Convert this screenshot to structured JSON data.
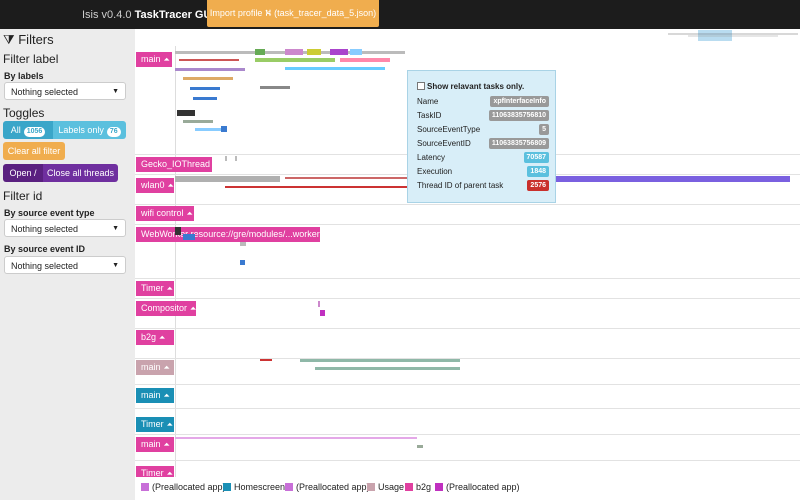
{
  "app": {
    "name": "Isis v0.4.0",
    "product": "TaskTracer GUI"
  },
  "import": {
    "label": "Import profile ⛕ (task_tracer_data_5.json)"
  },
  "sidebar": {
    "filters_heading": "Filters",
    "filter_label": "Filter label",
    "by_labels": "By labels",
    "by_labels_value": "Nothing selected",
    "toggles": "Toggles",
    "all": {
      "label": "All",
      "count": "1056"
    },
    "labels_only": {
      "label": "Labels only",
      "count": "76"
    },
    "clear_all": "Clear all filter",
    "open": "Open /",
    "close_all": "Close all threads",
    "filter_id": "Filter id",
    "by_source_event_type": "By source event type",
    "by_source_event_type_value": "Nothing selected",
    "by_source_event_id": "By source event ID",
    "by_source_event_id_value": "Nothing selected"
  },
  "threads": [
    {
      "label": "main",
      "color": "#e040a0"
    },
    {
      "label": "Gecko_IOThread",
      "color": "#e040a0"
    },
    {
      "label": "wlan0",
      "color": "#e040a0"
    },
    {
      "label": "wifi control",
      "color": "#e040a0"
    },
    {
      "label": "WebWorker resource://gre/modules/...worker.js",
      "color": "#e040a0"
    },
    {
      "label": "Timer",
      "color": "#e040a0"
    },
    {
      "label": "Compositor",
      "color": "#e040a0"
    },
    {
      "label": "b2g",
      "color": "#e040a0"
    },
    {
      "label": "main",
      "color": "#c9a3ad"
    },
    {
      "label": "main",
      "color": "#1a8fb5"
    },
    {
      "label": "Timer",
      "color": "#1a8fb5"
    },
    {
      "label": "main",
      "color": "#e040a0"
    },
    {
      "label": "Timer",
      "color": "#e040a0"
    }
  ],
  "tooltip": {
    "checkbox_label": "Show relavant tasks only.",
    "rows": [
      {
        "key": "Name",
        "value": "xpfInterfaceInfo",
        "color": "#999999"
      },
      {
        "key": "TaskID",
        "value": "11063835756810",
        "color": "#999999"
      },
      {
        "key": "SourceEventType",
        "value": "5",
        "color": "#999999"
      },
      {
        "key": "SourceEventID",
        "value": "11063835756809",
        "color": "#999999"
      },
      {
        "key": "Latency",
        "value": "70587",
        "color": "#5bc0de"
      },
      {
        "key": "Execution",
        "value": "1848",
        "color": "#5bc0de"
      },
      {
        "key": "Thread ID of parent task",
        "value": "2576",
        "color": "#c9302c"
      }
    ]
  },
  "legend": [
    {
      "label": "(Preallocated app)",
      "color": "#c86fd8"
    },
    {
      "label": "Homescreen",
      "color": "#1a8fb5"
    },
    {
      "label": "(Preallocated app)",
      "color": "#c86fd8"
    },
    {
      "label": "Usage",
      "color": "#c9a3ad"
    },
    {
      "label": "b2g",
      "color": "#e040a0"
    },
    {
      "label": "(Preallocated app)",
      "color": "#c030c0"
    }
  ]
}
